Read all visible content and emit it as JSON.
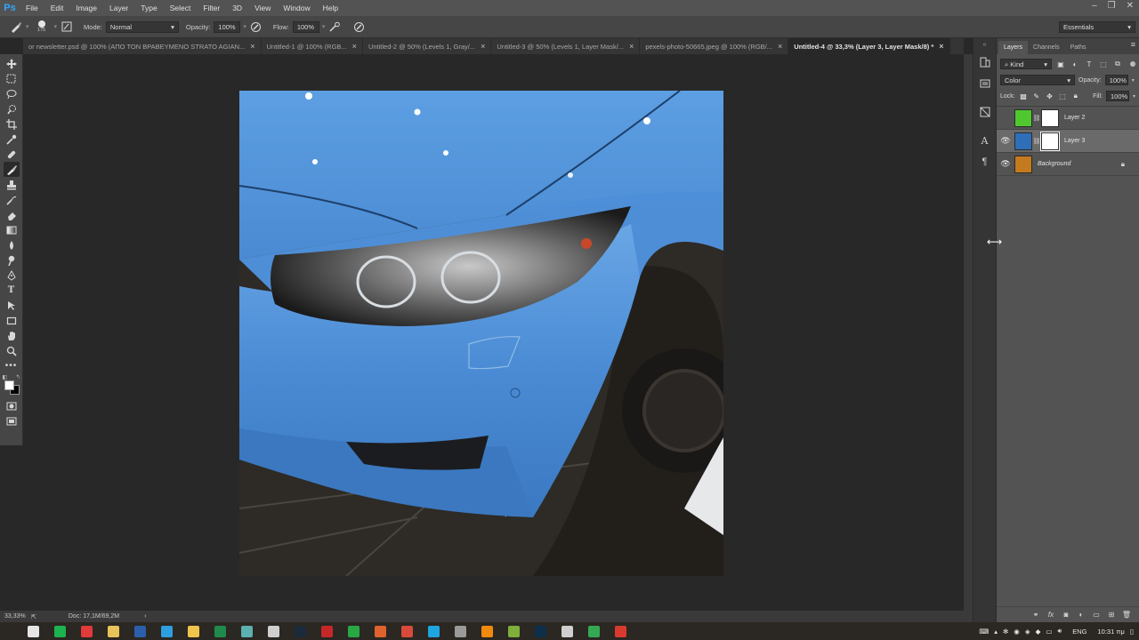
{
  "app": {
    "logo": "Ps",
    "menu": [
      "File",
      "Edit",
      "Image",
      "Layer",
      "Type",
      "Select",
      "Filter",
      "3D",
      "View",
      "Window",
      "Help"
    ],
    "window_controls": [
      "–",
      "❐",
      "✕"
    ]
  },
  "options_bar": {
    "brush_size": "175",
    "mode_label": "Mode:",
    "mode_value": "Normal",
    "opacity_label": "Opacity:",
    "opacity_value": "100%",
    "flow_label": "Flow:",
    "flow_value": "100%",
    "workspace": "Essentials"
  },
  "tabs": [
    {
      "title": "or newsletter.psd @ 100% (ΑΠΟ ΤΟΝ ΒΡΑΒΕΥΜΕΝΟ STRATO AGIAN...",
      "active": false
    },
    {
      "title": "Untitled-1 @ 100% (RGB...",
      "active": false
    },
    {
      "title": "Untitled-2 @ 50% (Levels 1, Gray/...",
      "active": false
    },
    {
      "title": "Untitled-3 @ 50% (Levels 1, Layer Mask/...",
      "active": false
    },
    {
      "title": "pexels-photo-50665.jpeg @ 100% (RGB/...",
      "active": false
    },
    {
      "title": "Untitled-4 @ 33,3% (Layer 3, Layer Mask/8) *",
      "active": true
    }
  ],
  "tab_close_glyph": "×",
  "status": {
    "zoom": "33,33%",
    "doc": "Doc: 17,1M/69,2M",
    "arrow": "›"
  },
  "layers_panel": {
    "tabs": [
      "Layers",
      "Channels",
      "Paths"
    ],
    "filter_kind": "Kind",
    "blend_mode": "Color",
    "opacity_label": "Opacity:",
    "opacity_value": "100%",
    "lock_label": "Lock:",
    "fill_label": "Fill:",
    "fill_value": "100%",
    "layers": [
      {
        "name": "Layer 2",
        "visible": false,
        "selected": false,
        "has_mask": true,
        "thumb_color": "#4fc830",
        "italic": false,
        "locked": false
      },
      {
        "name": "Layer 3",
        "visible": true,
        "selected": true,
        "has_mask": true,
        "thumb_color": "#2e6fb8",
        "italic": false,
        "locked": false
      },
      {
        "name": "Background",
        "visible": true,
        "selected": false,
        "has_mask": false,
        "thumb_color": "#c47a1e",
        "italic": true,
        "locked": true
      }
    ]
  },
  "taskbar": {
    "language": "ENG",
    "time": "10:31 πμ",
    "apps": [
      {
        "name": "task-view",
        "color": "#e6e6e6"
      },
      {
        "name": "edge-green",
        "color": "#1db34f"
      },
      {
        "name": "record",
        "color": "#e03a3a"
      },
      {
        "name": "explorer",
        "color": "#e8c35a"
      },
      {
        "name": "word",
        "color": "#2b5faa"
      },
      {
        "name": "globe",
        "color": "#2d9ee0"
      },
      {
        "name": "notes",
        "color": "#f0c44c"
      },
      {
        "name": "excel",
        "color": "#1f8a4c"
      },
      {
        "name": "monitor",
        "color": "#5db0b0"
      },
      {
        "name": "calculator",
        "color": "#cfcfcf"
      },
      {
        "name": "lightroom",
        "color": "#1a2a3a"
      },
      {
        "name": "filezilla",
        "color": "#c62828"
      },
      {
        "name": "pen",
        "color": "#27a844"
      },
      {
        "name": "chrome-like",
        "color": "#e0622d"
      },
      {
        "name": "media",
        "color": "#d84b3a"
      },
      {
        "name": "skype",
        "color": "#1ea6e0"
      },
      {
        "name": "link",
        "color": "#9a9a9a"
      },
      {
        "name": "vlc",
        "color": "#f08a0c"
      },
      {
        "name": "notepad",
        "color": "#7fae3c"
      },
      {
        "name": "photoshop",
        "color": "#0e2e4a"
      },
      {
        "name": "steam",
        "color": "#cfcfcf"
      },
      {
        "name": "chrome",
        "color": "#34a853"
      },
      {
        "name": "app-red",
        "color": "#d93a2f"
      }
    ]
  },
  "colors": {
    "accent": "#31a8ff",
    "car_blue": "#4a90d9"
  }
}
